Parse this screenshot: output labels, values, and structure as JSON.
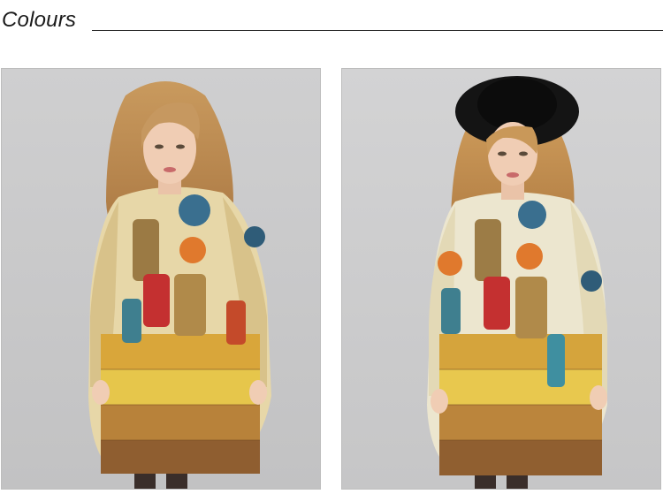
{
  "header": {
    "title": "Colours"
  },
  "photos": [
    {
      "label": "model-front-view",
      "background": "#c9c9ca"
    },
    {
      "label": "model-with-black-hat",
      "background": "#cdcdce"
    }
  ],
  "colors": {
    "accent_text": "#1a1a1a",
    "rule": "#2a2a2a"
  }
}
